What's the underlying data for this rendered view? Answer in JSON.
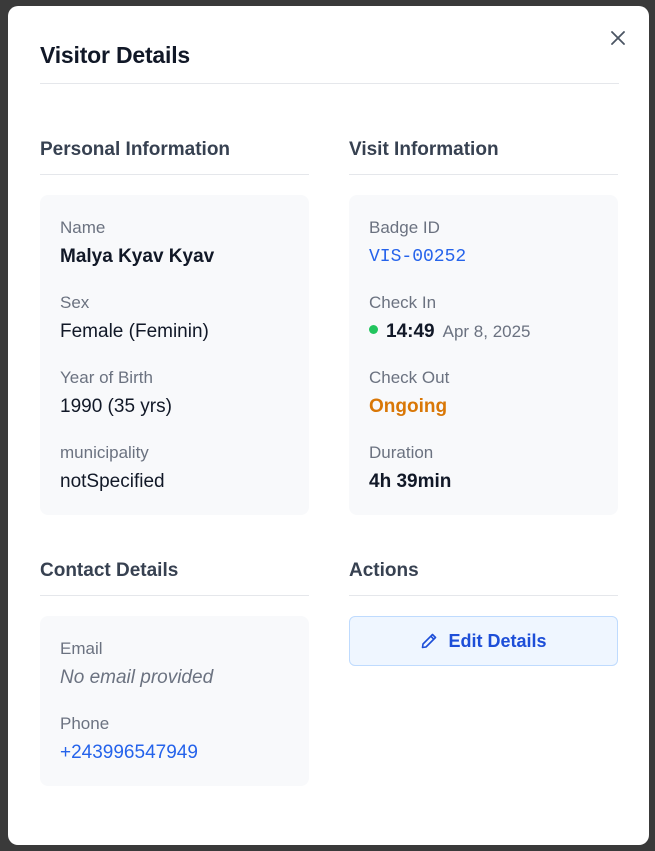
{
  "modal": {
    "title": "Visitor Details",
    "close_icon": "close-icon"
  },
  "personal": {
    "title": "Personal Information",
    "fields": [
      {
        "label": "Name",
        "value": "Malya Kyav Kyav"
      },
      {
        "label": "Sex",
        "value": "Female (Feminin)"
      },
      {
        "label": "Year of Birth",
        "value": "1990 (35 yrs)"
      },
      {
        "label": "municipality",
        "value": "notSpecified"
      }
    ]
  },
  "visit": {
    "title": "Visit Information",
    "badge_label": "Badge ID",
    "badge_value": "VIS-00252",
    "checkin_label": "Check In",
    "checkin_time": "14:49",
    "checkin_date": "Apr 8, 2025",
    "checkin_status_color": "#22c55e",
    "checkout_label": "Check Out",
    "checkout_value": "Ongoing",
    "duration_label": "Duration",
    "duration_value": "4h 39min"
  },
  "contact": {
    "title": "Contact Details",
    "email_label": "Email",
    "email_value": "No email provided",
    "phone_label": "Phone",
    "phone_value": "+243996547949"
  },
  "actions": {
    "title": "Actions",
    "edit_label": "Edit Details",
    "edit_icon": "pencil-icon"
  },
  "colors": {
    "accent": "#2563eb",
    "warning": "#d97706",
    "success": "#22c55e"
  }
}
